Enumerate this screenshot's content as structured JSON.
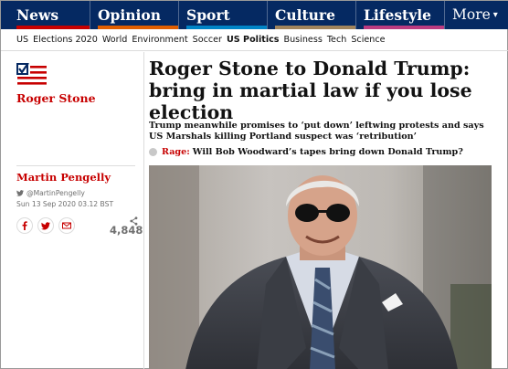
{
  "nav": {
    "pillars": [
      {
        "label": "News",
        "color": "#c70000"
      },
      {
        "label": "Opinion",
        "color": "#e05e00"
      },
      {
        "label": "Sport",
        "color": "#0084c6"
      },
      {
        "label": "Culture",
        "color": "#a1845c"
      },
      {
        "label": "Lifestyle",
        "color": "#bb3b80"
      }
    ],
    "more_label": "More",
    "background": "#052962"
  },
  "subnav": {
    "items": [
      "US",
      "Elections 2020",
      "World",
      "Environment",
      "Soccer",
      "US Politics",
      "Business",
      "Tech",
      "Science"
    ],
    "active": "US Politics"
  },
  "series": {
    "title": "Roger Stone",
    "icon": "ballot-checkbox-flag-icon"
  },
  "byline": {
    "author": "Martin Pengelly",
    "twitter": "@MartinPengelly",
    "date": "Sun 13 Sep 2020 03.12 BST"
  },
  "share": {
    "icons": [
      "facebook-icon",
      "twitter-icon",
      "email-icon"
    ],
    "count": "4,848"
  },
  "article": {
    "headline": "Roger Stone to Donald Trump: bring in martial law if you lose election",
    "standfirst": "Trump meanwhile promises to ‘put down’ leftwing protests and says US Marshals killing Portland suspect was ‘retribution’",
    "related_kicker": "Rage:",
    "related_title": "Will Bob Woodward’s tapes bring down Donald Trump?"
  },
  "colors": {
    "accent": "#c70000",
    "text": "#121212",
    "muted": "#707070"
  }
}
